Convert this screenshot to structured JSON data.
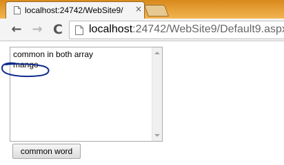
{
  "browser": {
    "tab": {
      "title": "localhost:24742/WebSite9/",
      "close_glyph": "×"
    },
    "nav": {
      "back_glyph": "←",
      "forward_glyph": "→",
      "reload_glyph": "C"
    },
    "address_bar": {
      "host": "localhost",
      "path": ":24742/WebSite9/Default9.aspx"
    }
  },
  "page": {
    "listbox": {
      "items": [
        "common in both array",
        "mango"
      ]
    },
    "button": {
      "label": "common word"
    }
  },
  "colors": {
    "tabstrip": "#e9a43a",
    "annotation_ink": "#0f2a8c"
  },
  "icons": [
    "page-icon",
    "close-icon",
    "back-arrow-icon",
    "forward-arrow-icon",
    "reload-icon",
    "scroll-up-arrow-icon",
    "scroll-down-arrow-icon"
  ]
}
